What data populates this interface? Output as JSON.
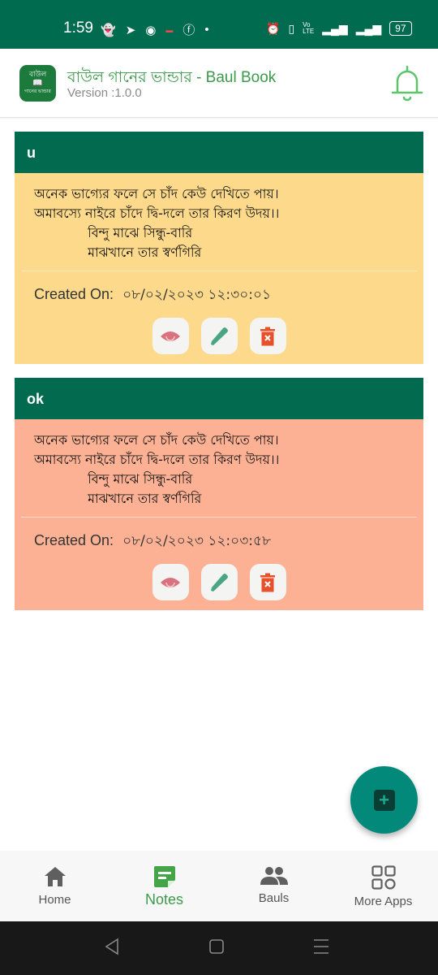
{
  "status_bar": {
    "time": "1:59",
    "left_icons": [
      "snapchat-icon",
      "telegram-icon",
      "messenger-icon",
      "app-notification-icon",
      "facebook-icon",
      "dot-icon"
    ],
    "right_icons": [
      "alarm-icon",
      "vibrate-icon",
      "volte-icon",
      "signal-1-icon",
      "signal-2-icon"
    ],
    "battery": "97"
  },
  "app_bar": {
    "icon_text_top": "বাউল",
    "icon_text_bottom": "গানের ভান্ডার",
    "title": "বাউল গানের ভান্ডার - Baul Book",
    "version": "Version :1.0.0",
    "bell_color": "#5cc56b"
  },
  "notes": [
    {
      "title": "u",
      "body_color": "#fdd98b",
      "lyrics": "অনেক ভাগ্যের ফলে সে চাঁদ কেউ দেখিতে পায়।\nঅমাবস্যে নাইরে চাঁদে দ্বি-দলে তার কিরণ উদয়।।\n             বিন্দু মাঝে সিন্ধু-বারি\n             মাঝখানে তার স্বর্ণগিরি",
      "created_label": "Created On:",
      "created_value": "০৮/০২/২০২৩ ১২:৩০:০১"
    },
    {
      "title": "ok",
      "body_color": "#fdb194",
      "lyrics": "অনেক ভাগ্যের ফলে সে চাঁদ কেউ দেখিতে পায়।\nঅমাবস্যে নাইরে চাঁদে দ্বি-দলে তার কিরণ উদয়।।\n             বিন্দু মাঝে সিন্ধু-বারি\n             মাঝখানে তার স্বর্ণগিরি",
      "created_label": "Created On:",
      "created_value": "০৮/০২/২০২৩ ১২:০৩:৫৮"
    }
  ],
  "fab": {
    "icon": "add-box-icon",
    "label": "+"
  },
  "bottom_nav": {
    "items": [
      {
        "label": "Home",
        "icon": "home-icon"
      },
      {
        "label": "Notes",
        "icon": "note-icon",
        "active": true
      },
      {
        "label": "Bauls",
        "icon": "people-icon"
      },
      {
        "label": "More Apps",
        "icon": "apps-grid-icon"
      }
    ]
  },
  "colors": {
    "primary": "#026b4f",
    "accent_green": "#3c9a4a",
    "fab": "#03897a"
  }
}
